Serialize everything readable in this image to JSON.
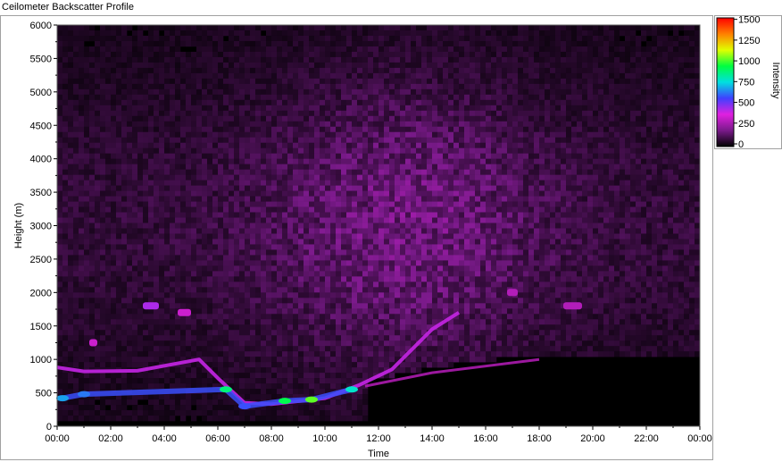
{
  "window": {
    "title": "Ceilometer Backscatter Profile"
  },
  "chart_data": {
    "type": "heatmap",
    "title": "Ceilometer Backscatter Profile",
    "xlabel": "Time",
    "ylabel": "Height (m)",
    "xlim": [
      "00:00",
      "24:00"
    ],
    "ylim": [
      0,
      6000
    ],
    "x_ticks": [
      "00:00",
      "02:00",
      "04:00",
      "06:00",
      "08:00",
      "10:00",
      "12:00",
      "14:00",
      "16:00",
      "18:00",
      "20:00",
      "22:00",
      "00:00"
    ],
    "y_ticks": [
      "0",
      "500",
      "1000",
      "1500",
      "2000",
      "2500",
      "3000",
      "3500",
      "4000",
      "4500",
      "5000",
      "5500",
      "6000"
    ],
    "colorbar": {
      "label": "Intensity",
      "ticks": [
        "0",
        "250",
        "500",
        "750",
        "1000",
        "1250",
        "1500"
      ],
      "range": [
        0,
        1550
      ],
      "colors": [
        "#000000",
        "#7a1a8a",
        "#e020e0",
        "#4040ff",
        "#00e0e0",
        "#00ff40",
        "#e0ff00",
        "#ff8000",
        "#ff0000"
      ]
    },
    "grid": false,
    "features": {
      "background_layer_intensity": {
        "min": 30,
        "max": 230
      },
      "boundary_layer_top": [
        {
          "time_h": 0.0,
          "height_m": 880
        },
        {
          "time_h": 1.0,
          "height_m": 820
        },
        {
          "time_h": 3.0,
          "height_m": 830
        },
        {
          "time_h": 5.3,
          "height_m": 1000
        },
        {
          "time_h": 6.0,
          "height_m": 720
        },
        {
          "time_h": 7.0,
          "height_m": 350
        },
        {
          "time_h": 8.0,
          "height_m": 330
        },
        {
          "time_h": 10.0,
          "height_m": 420
        },
        {
          "time_h": 11.3,
          "height_m": 620
        },
        {
          "time_h": 12.5,
          "height_m": 850
        },
        {
          "time_h": 14.0,
          "height_m": 1450
        },
        {
          "time_h": 15.0,
          "height_m": 1700
        }
      ],
      "low_cloud_base": [
        {
          "time_h": 0.2,
          "height_m": 420,
          "intensity": 700
        },
        {
          "time_h": 1.0,
          "height_m": 480,
          "intensity": 650
        },
        {
          "time_h": 6.3,
          "height_m": 550,
          "intensity": 900
        },
        {
          "time_h": 7.0,
          "height_m": 300,
          "intensity": 600
        },
        {
          "time_h": 8.5,
          "height_m": 380,
          "intensity": 950
        },
        {
          "time_h": 9.5,
          "height_m": 400,
          "intensity": 1050
        },
        {
          "time_h": 11.0,
          "height_m": 550,
          "intensity": 800
        }
      ],
      "elevated_layers": [
        {
          "time_start_h": 3.2,
          "time_end_h": 3.8,
          "height_m": 1800,
          "intensity": 450
        },
        {
          "time_start_h": 1.2,
          "time_end_h": 1.5,
          "height_m": 1250,
          "intensity": 350
        },
        {
          "time_start_h": 4.5,
          "time_end_h": 5.0,
          "height_m": 1700,
          "intensity": 350
        },
        {
          "time_start_h": 16.8,
          "time_end_h": 17.2,
          "height_m": 2000,
          "intensity": 300
        },
        {
          "time_start_h": 18.9,
          "time_end_h": 19.6,
          "height_m": 1800,
          "intensity": 300
        }
      ],
      "residual_layer_top": [
        {
          "time_h": 11.5,
          "height_m": 600
        },
        {
          "time_h": 14.0,
          "height_m": 800
        },
        {
          "time_h": 18.0,
          "height_m": 1000
        }
      ]
    }
  }
}
